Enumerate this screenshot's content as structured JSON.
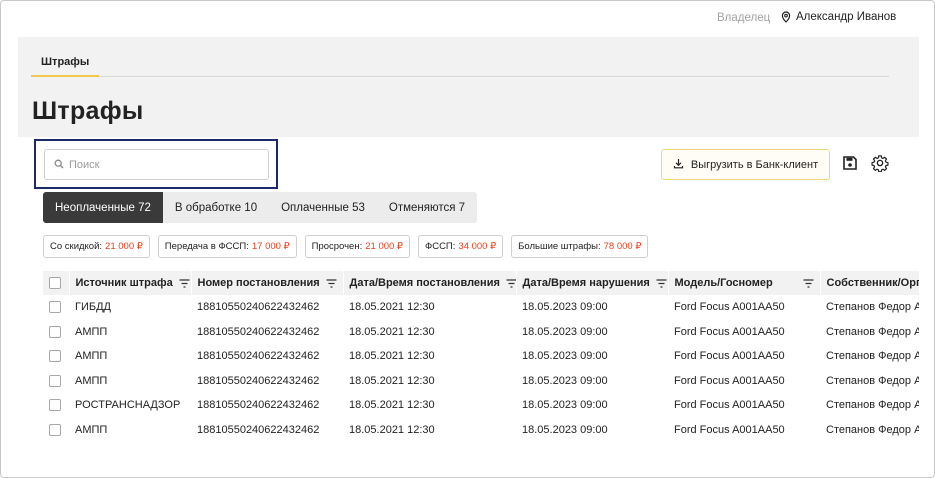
{
  "header": {
    "owner_label": "Владелец",
    "user_name": "Александр Иванов",
    "user_icon": "location-pin-icon"
  },
  "nav": {
    "tab_label": "Штрафы"
  },
  "page": {
    "title": "Штрафы"
  },
  "search": {
    "placeholder": "Поиск",
    "value": "",
    "icon": "search-icon"
  },
  "toolbar": {
    "export_label": "Выгрузить в Банк-клиент",
    "export_icon": "download-icon",
    "save_icon": "save-icon",
    "settings_icon": "gear-icon"
  },
  "status_tabs": [
    {
      "label": "Неоплаченные 72",
      "active": true
    },
    {
      "label": "В обработке 10",
      "active": false
    },
    {
      "label": "Оплаченные 53",
      "active": false
    },
    {
      "label": "Отменяются 7",
      "active": false
    }
  ],
  "chips": [
    {
      "label": "Со скидкой:",
      "amount": "21 000 ₽"
    },
    {
      "label": "Передача в ФССП:",
      "amount": "17 000 ₽"
    },
    {
      "label": "Просрочен:",
      "amount": "21 000 ₽"
    },
    {
      "label": "ФССП:",
      "amount": "34 000 ₽"
    },
    {
      "label": "Большие штрафы:",
      "amount": "78 000 ₽"
    }
  ],
  "colors": {
    "accent": "#f2c94c",
    "amount": "#e0451f",
    "active_tab": "#3a3a3a",
    "focus_outline": "#1c2a6b"
  },
  "table": {
    "columns": [
      "Источник штрафа",
      "Номер постановления",
      "Дата/Время постановления",
      "Дата/Время нарушения",
      "Модель/Госномер",
      "Собственник/Орга"
    ],
    "rows": [
      [
        "ГИБДД",
        "18810550240622432462",
        "18.05.2021 12:30",
        "18.05.2023 09:00",
        "Ford Focus A001AA50",
        "Степанов Федор А."
      ],
      [
        "АМПП",
        "18810550240622432462",
        "18.05.2021 12:30",
        "18.05.2023 09:00",
        "Ford Focus A001AA50",
        "Степанов Федор А."
      ],
      [
        "АМПП",
        "18810550240622432462",
        "18.05.2021 12:30",
        "18.05.2023 09:00",
        "Ford Focus A001AA50",
        "Степанов Федор А."
      ],
      [
        "АМПП",
        "18810550240622432462",
        "18.05.2021 12:30",
        "18.05.2023 09:00",
        "Ford Focus A001AA50",
        "Степанов Федор А."
      ],
      [
        "РОСТРАНСНАДЗОР",
        "18810550240622432462",
        "18.05.2021 12:30",
        "18.05.2023 09:00",
        "Ford Focus A001AA50",
        "Степанов Федор А."
      ],
      [
        "АМПП",
        "18810550240622432462",
        "18.05.2021 12:30",
        "18.05.2023 09:00",
        "Ford Focus A001AA50",
        "Степанов Федор А."
      ]
    ]
  }
}
